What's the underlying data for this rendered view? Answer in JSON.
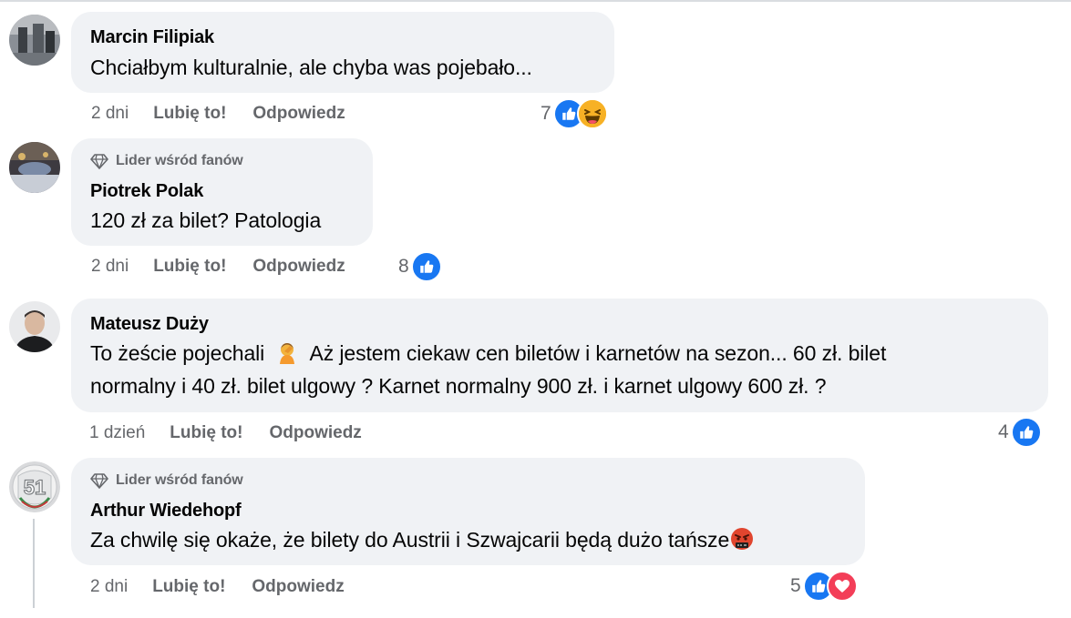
{
  "labels": {
    "like": "Lubię to!",
    "reply": "Odpowiedz",
    "fan_badge": "Lider wśród fanów"
  },
  "colors": {
    "bubble_bg": "#f0f2f5",
    "secondary_text": "#65676b",
    "like_blue": "#1877f2",
    "love_red": "#f33e58",
    "haha_yellow": "#f7b125"
  },
  "comments": [
    {
      "author": "Marcin Filipiak",
      "text": "Chciałbym kulturalnie, ale chyba was pojebało...",
      "time": "2 dni",
      "reaction_count": "7",
      "reactions": [
        "like-icon",
        "haha-icon"
      ]
    },
    {
      "badge": "Lider wśród fanów",
      "author": "Piotrek Polak",
      "text": "120 zł za bilet? Patologia",
      "time": "2 dni",
      "reaction_count": "8",
      "reactions": [
        "like-icon"
      ]
    },
    {
      "author": "Mateusz Duży",
      "text_line1_a": "To żeście pojechali",
      "text_line1_b": "Aż jestem ciekaw cen biletów i karnetów na sezon... 60 zł. bilet",
      "text_line2": "normalny i 40 zł. bilet ulgowy ? Karnet normalny 900 zł. i karnet ulgowy 600 zł. ?",
      "emoji": "person-facepalming-emoji",
      "time": "1 dzień",
      "reaction_count": "4",
      "reactions": [
        "like-icon"
      ]
    },
    {
      "badge": "Lider wśród fanów",
      "author": "Arthur Wiedehopf",
      "text": "Za chwilę się okaże, że bilety do Austrii i Szwajcarii będą dużo tańsze",
      "emoji": "cursing-face-emoji",
      "avatar_text": "51",
      "time": "2 dni",
      "reaction_count": "5",
      "reactions": [
        "like-icon",
        "love-icon"
      ]
    }
  ]
}
